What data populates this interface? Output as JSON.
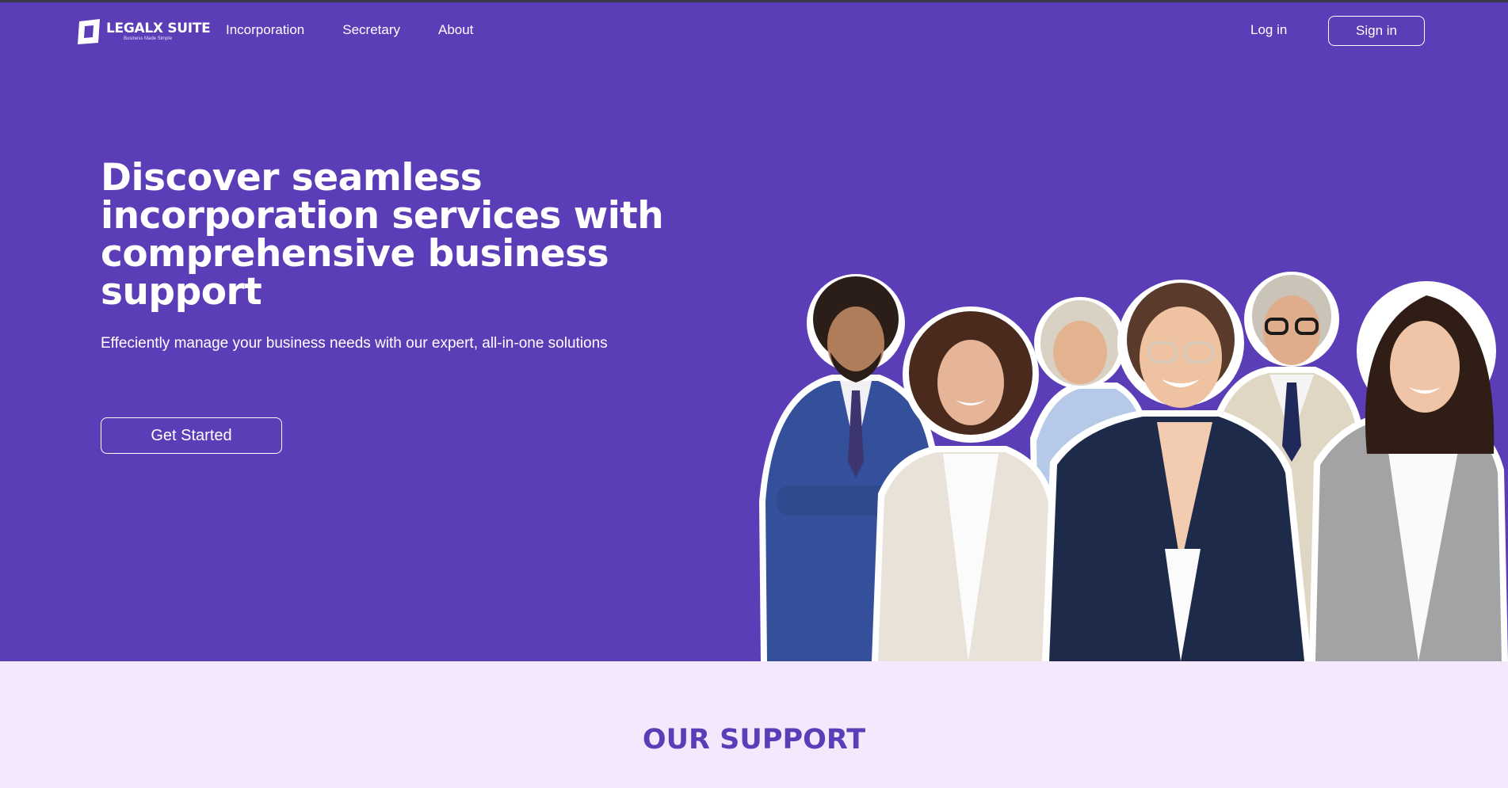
{
  "brand": {
    "name": "LEGALX SUITE",
    "tagline": "Business Made Simple"
  },
  "nav": {
    "links": [
      "Incorporation",
      "Secretary",
      "About"
    ],
    "login": "Log in",
    "signin": "Sign in"
  },
  "hero": {
    "headline": "Discover seamless incorporation services with comprehensive business support",
    "subtitle": "Effeciently manage your business needs with our expert, all-in-one solutions",
    "cta": "Get Started"
  },
  "section": {
    "title": "OUR SUPPORT"
  },
  "colors": {
    "primary": "#5a3db7",
    "section_bg": "#f4e8fd",
    "text_light": "#ffffff"
  }
}
